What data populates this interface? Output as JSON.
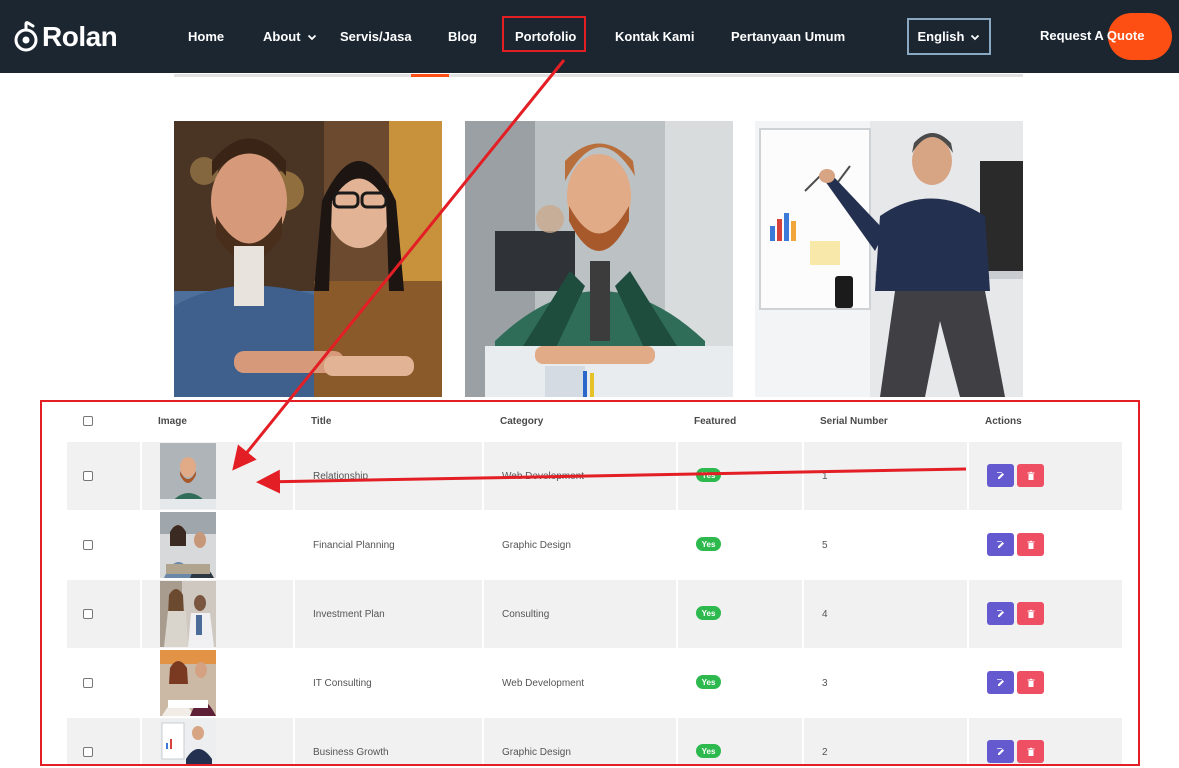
{
  "nav": {
    "brand": "Rolan",
    "items": [
      "Home",
      "About",
      "Servis/Jasa",
      "Blog",
      "Portofolio",
      "Kontak Kami",
      "Pertanyaan Umum"
    ],
    "language": "English",
    "cta": "Request A Quote"
  },
  "table": {
    "headers": [
      "Image",
      "Title",
      "Category",
      "Featured",
      "Serial Number",
      "Actions"
    ],
    "rows": [
      {
        "title": "Relationship",
        "category": "Web Development",
        "featured": "Yes",
        "serial": "1"
      },
      {
        "title": "Financial Planning",
        "category": "Graphic Design",
        "featured": "Yes",
        "serial": "5"
      },
      {
        "title": "Investment Plan",
        "category": "Consulting",
        "featured": "Yes",
        "serial": "4"
      },
      {
        "title": "IT Consulting",
        "category": "Web Development",
        "featured": "Yes",
        "serial": "3"
      },
      {
        "title": "Business Growth",
        "category": "Graphic Design",
        "featured": "Yes",
        "serial": "2"
      }
    ]
  },
  "icons": {
    "logo": "rolan-logo-icon",
    "dropdown": "chevron-down-icon",
    "edit": "edit-icon",
    "delete": "trash-icon",
    "annotation": "arrow-icon"
  },
  "colors": {
    "navbar": "#1b2631",
    "accent": "#fd4f14",
    "highlight": "#e31e24",
    "featured": "#2db94d",
    "edit": "#6459cf",
    "delete": "#ee4f63"
  }
}
